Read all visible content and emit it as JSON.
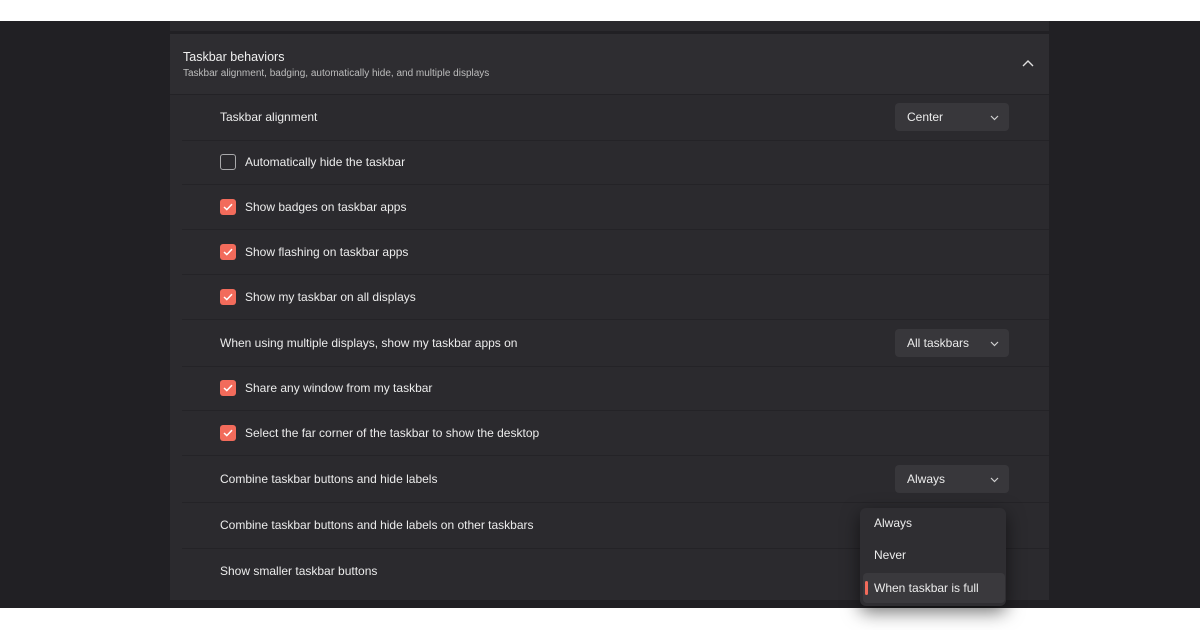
{
  "section": {
    "title": "Taskbar behaviors",
    "subtitle": "Taskbar alignment, badging, automatically hide, and multiple displays",
    "expanded": true
  },
  "settings": {
    "alignment": {
      "label": "Taskbar alignment",
      "value": "Center"
    },
    "auto_hide": {
      "label": "Automatically hide the taskbar",
      "checked": false
    },
    "badges": {
      "label": "Show badges on taskbar apps",
      "checked": true
    },
    "flashing": {
      "label": "Show flashing on taskbar apps",
      "checked": true
    },
    "all_displays": {
      "label": "Show my taskbar on all displays",
      "checked": true
    },
    "multi_display_apps": {
      "label": "When using multiple displays, show my taskbar apps on",
      "value": "All taskbars"
    },
    "share_window": {
      "label": "Share any window from my taskbar",
      "checked": true
    },
    "far_corner": {
      "label": "Select the far corner of the taskbar to show the desktop",
      "checked": true
    },
    "combine": {
      "label": "Combine taskbar buttons and hide labels",
      "value": "Always"
    },
    "combine_other": {
      "label": "Combine taskbar buttons and hide labels on other taskbars"
    },
    "smaller_buttons": {
      "label": "Show smaller taskbar buttons"
    }
  },
  "dropdown_menu": {
    "options": [
      "Always",
      "Never",
      "When taskbar is full"
    ],
    "highlighted": "When taskbar is full"
  },
  "colors": {
    "accent": "#f26b5b",
    "background": "#212024",
    "panel": "#2b2a2e"
  }
}
